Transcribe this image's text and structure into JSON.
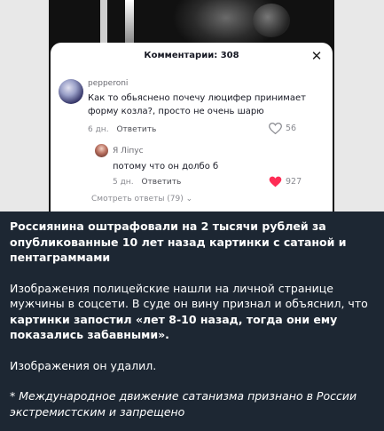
{
  "comments_sheet": {
    "title": "Комментарии: 308",
    "close_icon": "close-icon",
    "comment": {
      "username": "pepperoni",
      "text_line1": "Как то обьяснено почечу люцифер принимает",
      "text_line2": "форму козла?, просто не очень шарю",
      "time": "6 дн.",
      "reply_label": "Ответить",
      "likes": "56"
    },
    "reply": {
      "username": "Я Ліпус",
      "text": "потому что он долбо б",
      "time": "5 дн.",
      "reply_label": "Ответить",
      "likes": "927"
    },
    "more_replies": "Смотреть ответы (79)"
  },
  "post": {
    "headline": "Россиянина оштрафовали на 2 тысячи рублей за опубликованные 10 лет назад картинки с сатаной и пентаграммами",
    "para2_plain": "Изображения полицейские нашли на личной странице мужчины в соцсети. В суде он вину признал и объяснил, что ",
    "para2_bold": "картинки запостил «лет 8-10 назад, тогда они ему показались забавными».",
    "para3": "Изображения он удалил.",
    "para4": "* Международное движение сатанизма признано в России экстремистским и запрещено"
  },
  "colors": {
    "background": "#1d2733",
    "liked_heart": "#fe2c55"
  }
}
